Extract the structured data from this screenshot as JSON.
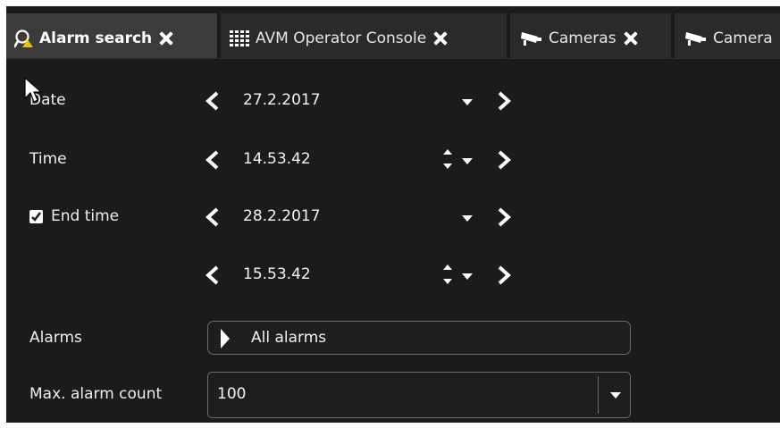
{
  "tabs": [
    {
      "label": "Alarm search",
      "icon": "search-alarm-icon",
      "active": true
    },
    {
      "label": "AVM Operator Console",
      "icon": "grid-icon",
      "active": false
    },
    {
      "label": "Cameras",
      "icon": "camera-icon",
      "active": false
    },
    {
      "label": "Camera",
      "icon": "camera-icon",
      "active": false
    }
  ],
  "form": {
    "date_label": "Date",
    "date_value": "27.2.2017",
    "time_label": "Time",
    "time_value": "14.53.42",
    "end_time_label": "End time",
    "end_time_checked": true,
    "end_date_value": "28.2.2017",
    "end_time_value": "15.53.42",
    "alarms_label": "Alarms",
    "alarms_value": "All alarms",
    "max_count_label": "Max. alarm count",
    "max_count_value": "100"
  },
  "colors": {
    "background": "#1b1b1b",
    "tab_active": "#3b3b3b",
    "tab_inactive": "#2a2a2a",
    "text": "#f0f0f0",
    "border": "#6a6a6a"
  }
}
